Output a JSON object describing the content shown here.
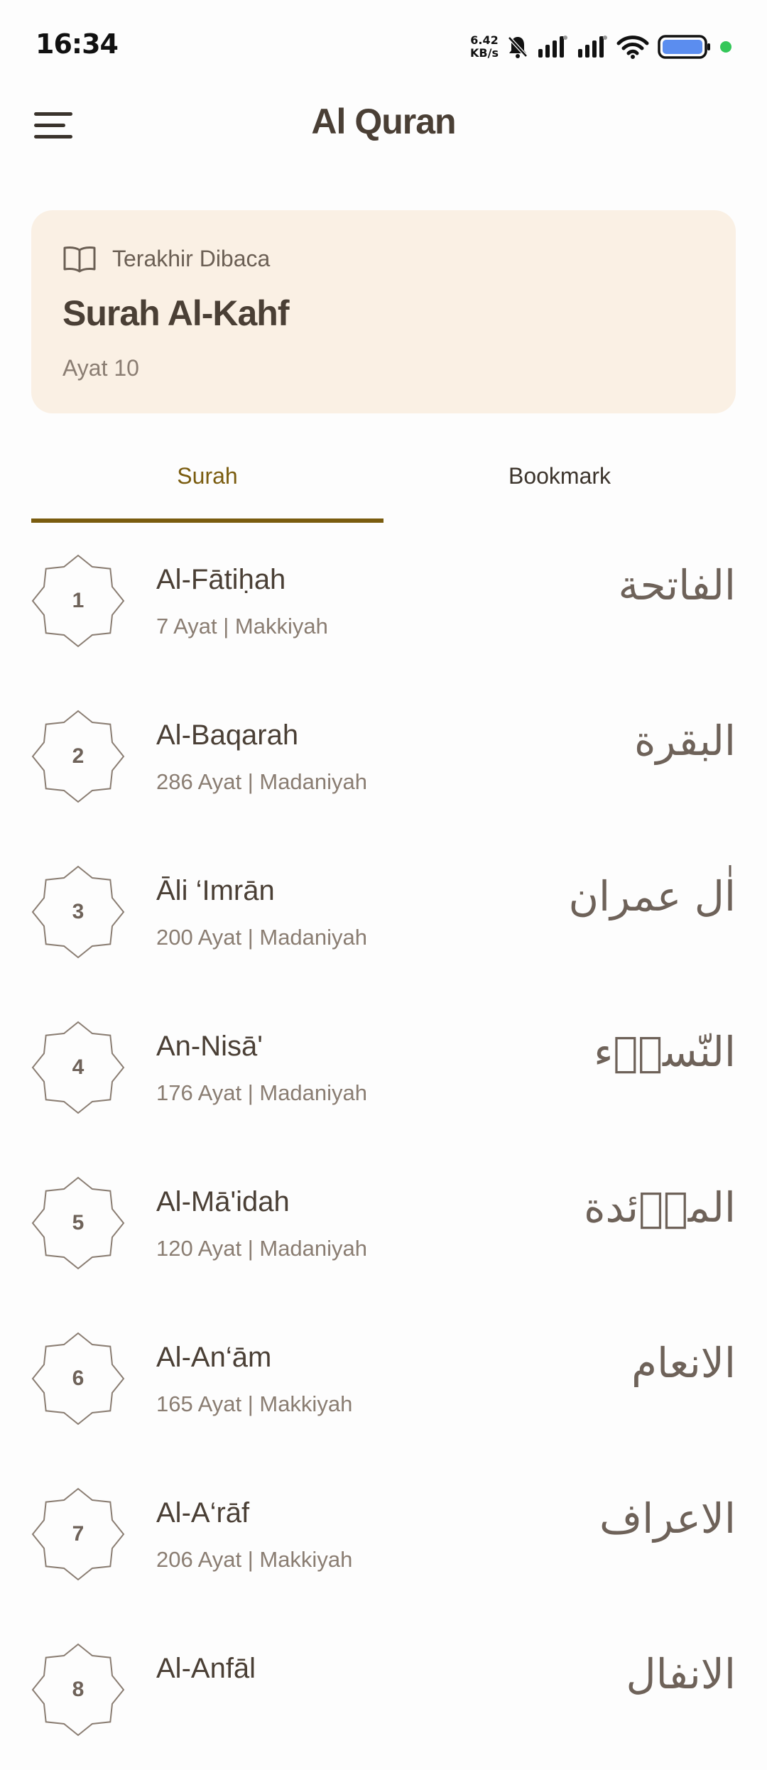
{
  "status_bar": {
    "time": "16:34",
    "net_speed_value": "6.42",
    "net_speed_unit": "KB/s"
  },
  "app_bar": {
    "title": "Al Quran",
    "menu_icon": "hamburger-menu-icon"
  },
  "last_read": {
    "icon": "open-book-icon",
    "label": "Terakhir Dibaca",
    "surah": "Surah Al-Kahf",
    "ayat": "Ayat 10"
  },
  "tabs": [
    {
      "label": "Surah",
      "active": true
    },
    {
      "label": "Bookmark",
      "active": false
    }
  ],
  "colors": {
    "accent": "#7a5c0f",
    "card_bg": "#faf0e4",
    "text_primary": "#4a3f35",
    "text_secondary": "#8a7d72"
  },
  "surahs": [
    {
      "number": "1",
      "name": "Al-Fātiḥah",
      "meta": "7 Ayat | Makkiyah",
      "arabic": "الفاتحة"
    },
    {
      "number": "2",
      "name": "Al-Baqarah",
      "meta": "286 Ayat | Madaniyah",
      "arabic": "البقرة"
    },
    {
      "number": "3",
      "name": "Āli ‘Imrān",
      "meta": "200 Ayat | Madaniyah",
      "arabic": "اٰل عمران"
    },
    {
      "number": "4",
      "name": "An-Nisā'",
      "meta": "176 Ayat | Madaniyah",
      "arabic": "النّساۤء"
    },
    {
      "number": "5",
      "name": "Al-Mā'idah",
      "meta": "120 Ayat | Madaniyah",
      "arabic": "الماۤئدة"
    },
    {
      "number": "6",
      "name": "Al-An‘ām",
      "meta": "165 Ayat | Makkiyah",
      "arabic": "الانعام"
    },
    {
      "number": "7",
      "name": "Al-A‘rāf",
      "meta": "206 Ayat | Makkiyah",
      "arabic": "الاعراف"
    },
    {
      "number": "8",
      "name": "Al-Anfāl",
      "meta": "",
      "arabic": "الانفال"
    }
  ]
}
